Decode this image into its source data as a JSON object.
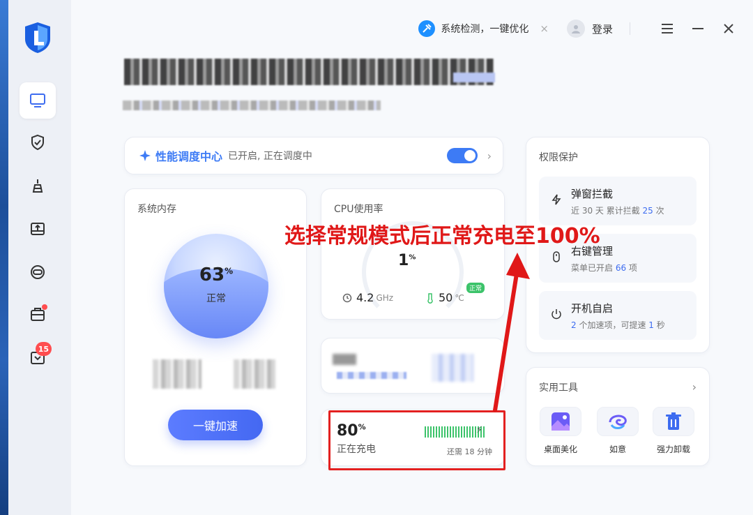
{
  "topbar": {
    "optimize_label": "系统检测，一键优化",
    "close_x": "×",
    "login_label": "登录"
  },
  "sidebar": {
    "badge_count": "15"
  },
  "perf": {
    "title": "性能调度中心",
    "status": "已开启, 正在调度中",
    "chevron": "›"
  },
  "memory": {
    "label": "系统内存",
    "value": "63",
    "unit": "%",
    "state": "正常",
    "boost_label": "一键加速"
  },
  "cpu": {
    "label": "CPU使用率",
    "value": "1",
    "unit": "%",
    "freq": "4.2",
    "freq_unit": "GHz",
    "temp": "50",
    "temp_unit": "℃",
    "temp_badge": "正常"
  },
  "battery": {
    "value": "80",
    "unit": "%",
    "state": "正在充电",
    "remain": "还需 18 分钟"
  },
  "permissions": {
    "label": "权限保护",
    "items": [
      {
        "title": "弹窗拦截",
        "desc_pre": "近 30 天 累计拦截 ",
        "desc_num": "25",
        "desc_post": " 次"
      },
      {
        "title": "右键管理",
        "desc_pre": "菜单已开启 ",
        "desc_num": "66",
        "desc_post": " 项"
      },
      {
        "title": "开机自启",
        "desc_num": "2",
        "desc_pre": "",
        "desc_post": " 个加速项，可提速 ",
        "desc_num2": "1",
        "desc_post2": " 秒"
      }
    ]
  },
  "tools": {
    "label": "实用工具",
    "chevron": "›",
    "items": [
      {
        "label": "桌面美化"
      },
      {
        "label": "如意"
      },
      {
        "label": "强力卸载"
      }
    ]
  },
  "annotation": {
    "text": "选择常规模式后正常充电至100%"
  },
  "colors": {
    "accent": "#3d7bf5",
    "annotation": "#e01818",
    "battery_green": "#3cc36a"
  }
}
